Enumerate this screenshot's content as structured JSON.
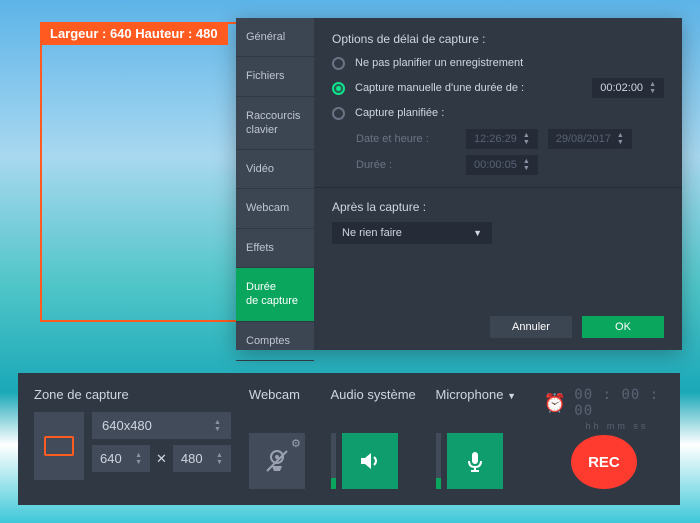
{
  "captureFrame": {
    "label": "Largeur : 640  Hauteur : 480"
  },
  "dialog": {
    "tabs": [
      "Général",
      "Fichiers",
      "Raccourcis clavier",
      "Vidéo",
      "Webcam",
      "Effets",
      "Durée\nde capture",
      "Comptes"
    ],
    "activeTab": 6,
    "panel": {
      "title": "Options de délai de capture :",
      "opt1": "Ne pas planifier un enregistrement",
      "opt2": "Capture manuelle d'une durée de :",
      "opt2_time": "00:02:00",
      "opt3": "Capture planifiée :",
      "sched_datetime_label": "Date et heure :",
      "sched_time": "12:26:29",
      "sched_date": "29/08/2017",
      "sched_duration_label": "Durée :",
      "sched_duration": "00:00:05",
      "after_label": "Après la capture :",
      "after_value": "Ne rien faire",
      "cancel": "Annuler",
      "ok": "OK"
    }
  },
  "toolbar": {
    "zone_title": "Zone de capture",
    "preset": "640x480",
    "width": "640",
    "height": "480",
    "webcam_title": "Webcam",
    "audio_title": "Audio système",
    "mic_title": "Microphone",
    "time": "00 : 00 : 00",
    "time_units": "hh  mm  ss",
    "rec": "REC"
  }
}
